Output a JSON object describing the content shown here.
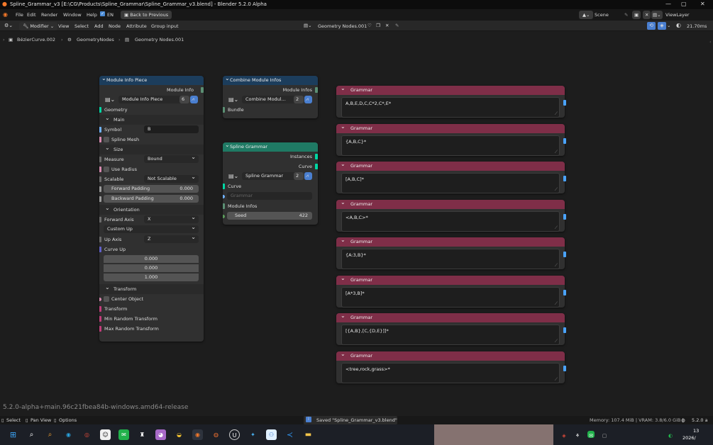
{
  "window": {
    "title": "Spline_Grammar_v3 [E:\\CG\\Products\\Spline_Grammar\\Spline_Grammar_v3.blend] - Blender 5.2.0 Alpha"
  },
  "menubar": {
    "items": [
      "File",
      "Edit",
      "Render",
      "Window",
      "Help"
    ],
    "en_label": "EN",
    "back_label": "Back to Previous",
    "scene_label": "Scene",
    "viewlayer_label": "ViewLayer"
  },
  "header": {
    "modifier_label": "Modifier",
    "menus": [
      "View",
      "Select",
      "Add",
      "Node",
      "Attribute",
      "Group input"
    ],
    "node_group": "Geometry Nodes.001",
    "timing": "21.70ms"
  },
  "breadcrumb": [
    "BézierCurve.002",
    "GeometryNodes",
    "Geometry Nodes.001"
  ],
  "module_info_piece": {
    "title": "Module Info Piece",
    "out_label": "Module Info",
    "group_name": "Module Info Piece",
    "user_count": "6",
    "geometry": "Geometry",
    "main": "Main",
    "symbol_label": "Symbol",
    "symbol_value": "B",
    "spline_mesh": "Spline Mesh",
    "size": "Size",
    "measure_label": "Measure",
    "measure_value": "Bound",
    "use_radius": "Use Radius",
    "scalable_label": "Scalable",
    "scalable_value": "Not Scalable",
    "forward_padding_label": "Forward Padding",
    "forward_padding_value": "0.000",
    "backward_padding_label": "Backward Padding",
    "backward_padding_value": "0.000",
    "orientation": "Orientation",
    "forward_axis_label": "Forward Axis",
    "forward_axis_value": "X",
    "custom_up": "Custom Up",
    "up_axis_label": "Up Axis",
    "up_axis_value": "Z",
    "curve_up": "Curve Up",
    "curve_up_x": "0.000",
    "curve_up_y": "0.000",
    "curve_up_z": "1.000",
    "transform_section": "Transform",
    "center_object": "Center Object",
    "transform": "Transform",
    "min_random": "Min Random Transform",
    "max_random": "Max Random Transform"
  },
  "combine_node": {
    "title": "Combine Module Infos",
    "out_label": "Module Infos",
    "group_name": "Combine Modul...",
    "user_count": "2",
    "bundle": "Bundle"
  },
  "spline_grammar_node": {
    "title": "Spline Grammar",
    "out_instances": "Instances",
    "out_curve": "Curve",
    "group_name": "Spline Grammar",
    "user_count": "2",
    "curve": "Curve",
    "grammar_placeholder": "Grammar",
    "module_infos": "Module Infos",
    "seed_label": "Seed",
    "seed_value": "422"
  },
  "grammar_nodes": [
    {
      "title": "Grammar",
      "value": "A,B,E,D,C,C*2,C*,E*"
    },
    {
      "title": "Grammar",
      "value": "{A,B,C}*"
    },
    {
      "title": "Grammar",
      "value": "[A,B,C]*"
    },
    {
      "title": "Grammar",
      "value": "<A,B,C>*"
    },
    {
      "title": "Grammar",
      "value": "{A:3,B}*"
    },
    {
      "title": "Grammar",
      "value": "[A*3,B]*"
    },
    {
      "title": "Grammar",
      "value": "[{A,B},[C,{D,E}]]*"
    },
    {
      "title": "Grammar",
      "value": "<tree,rock,grass>*"
    }
  ],
  "version_text": "5.2.0-alpha+main.96c21fbea84b-windows.amd64-release",
  "statusbar": {
    "select": "Select",
    "pan": "Pan View",
    "options": "Options",
    "saved": "Saved \"Spline_Grammar_v3.blend\"",
    "memory": "Memory: 107.4 MiB | VRAM: 3.8/6.0 GiB |",
    "version": "5.2.0 a"
  },
  "taskbar": {
    "time": "13",
    "date": "2026/"
  },
  "colors": {
    "group_header": "#1c3d5c",
    "spline_header": "#1f7a64",
    "grammar_header": "#7f2e48",
    "geometry_socket": "#00d6a3",
    "string_socket": "#70b2ff",
    "bundle_socket": "#5b8f73"
  }
}
